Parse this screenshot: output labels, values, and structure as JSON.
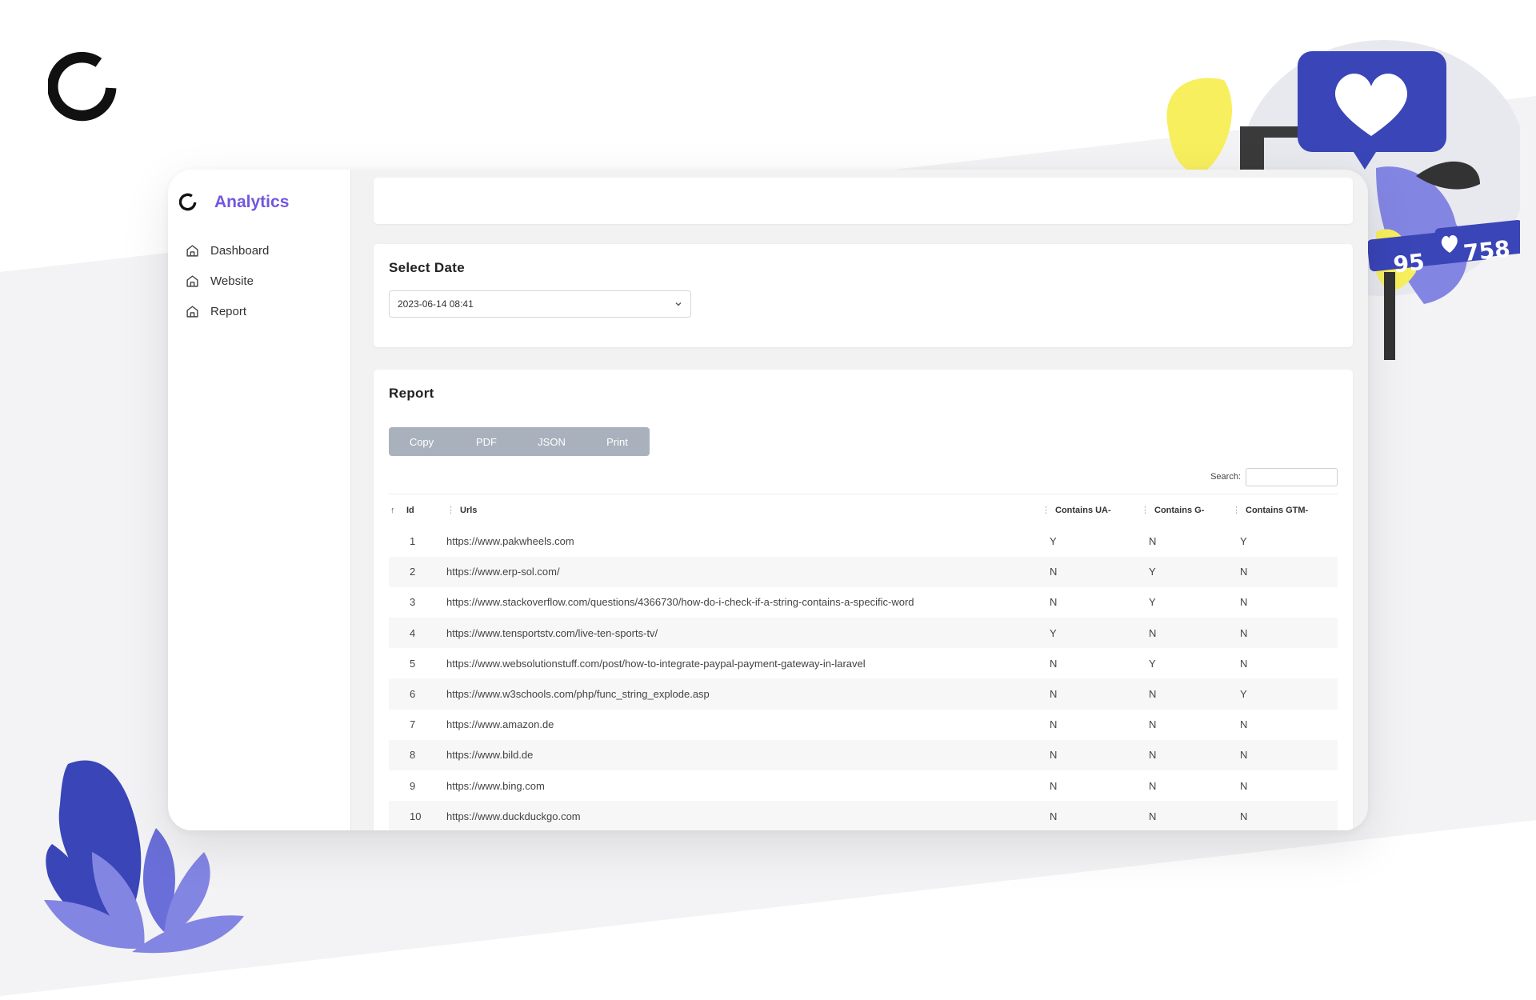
{
  "app": {
    "brand_name": "Analytics"
  },
  "sidebar": {
    "items": [
      {
        "label": "Dashboard",
        "icon": "home-icon"
      },
      {
        "label": "Website",
        "icon": "home-icon"
      },
      {
        "label": "Report",
        "icon": "home-icon"
      }
    ]
  },
  "date_card": {
    "title": "Select Date",
    "selected": "2023-06-14 08:41"
  },
  "report": {
    "title": "Report",
    "buttons": {
      "copy": "Copy",
      "pdf": "PDF",
      "json": "JSON",
      "print": "Print"
    },
    "search_label": "Search:",
    "columns": {
      "id": "Id",
      "urls": "Urls",
      "ua": "Contains UA-",
      "g": "Contains G-",
      "gtm": "Contains GTM-"
    },
    "rows": [
      {
        "id": "1",
        "url": "https://www.pakwheels.com",
        "ua": "Y",
        "g": "N",
        "gtm": "Y"
      },
      {
        "id": "2",
        "url": "https://www.erp-sol.com/",
        "ua": "N",
        "g": "Y",
        "gtm": "N"
      },
      {
        "id": "3",
        "url": "https://www.stackoverflow.com/questions/4366730/how-do-i-check-if-a-string-contains-a-specific-word",
        "ua": "N",
        "g": "Y",
        "gtm": "N"
      },
      {
        "id": "4",
        "url": "https://www.tensportstv.com/live-ten-sports-tv/",
        "ua": "Y",
        "g": "N",
        "gtm": "N"
      },
      {
        "id": "5",
        "url": "https://www.websolutionstuff.com/post/how-to-integrate-paypal-payment-gateway-in-laravel",
        "ua": "N",
        "g": "Y",
        "gtm": "N"
      },
      {
        "id": "6",
        "url": "https://www.w3schools.com/php/func_string_explode.asp",
        "ua": "N",
        "g": "N",
        "gtm": "Y"
      },
      {
        "id": "7",
        "url": "https://www.amazon.de",
        "ua": "N",
        "g": "N",
        "gtm": "N"
      },
      {
        "id": "8",
        "url": "https://www.bild.de",
        "ua": "N",
        "g": "N",
        "gtm": "N"
      },
      {
        "id": "9",
        "url": "https://www.bing.com",
        "ua": "N",
        "g": "N",
        "gtm": "N"
      },
      {
        "id": "10",
        "url": "https://www.duckduckgo.com",
        "ua": "N",
        "g": "N",
        "gtm": "N"
      }
    ]
  },
  "decor": {
    "followers_count": "95",
    "likes_count": "758"
  },
  "colors": {
    "brand": "#7256de",
    "button_group": "#a9b2bc",
    "decor_blue": "#3a45b8",
    "decor_violet": "#8385e3",
    "decor_yellow": "#f7ef5d"
  }
}
